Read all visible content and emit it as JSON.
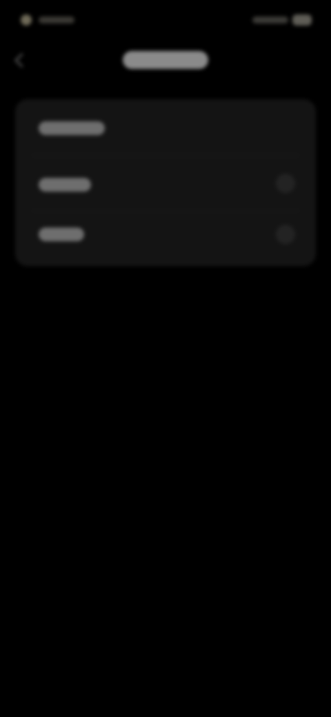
{
  "status_bar": {
    "time": "",
    "icons": [
      "signal-icon",
      "wifi-icon",
      "battery-icon"
    ]
  },
  "header": {
    "title": "",
    "back_icon": "chevron-left-icon"
  },
  "settings_list": {
    "items": [
      {
        "label": "",
        "has_chevron": false
      },
      {
        "label": "",
        "has_chevron": true
      },
      {
        "label": "",
        "has_chevron": true
      }
    ]
  },
  "colors": {
    "background": "#000000",
    "card": "#141414",
    "text_primary": "#d8d8d8"
  }
}
